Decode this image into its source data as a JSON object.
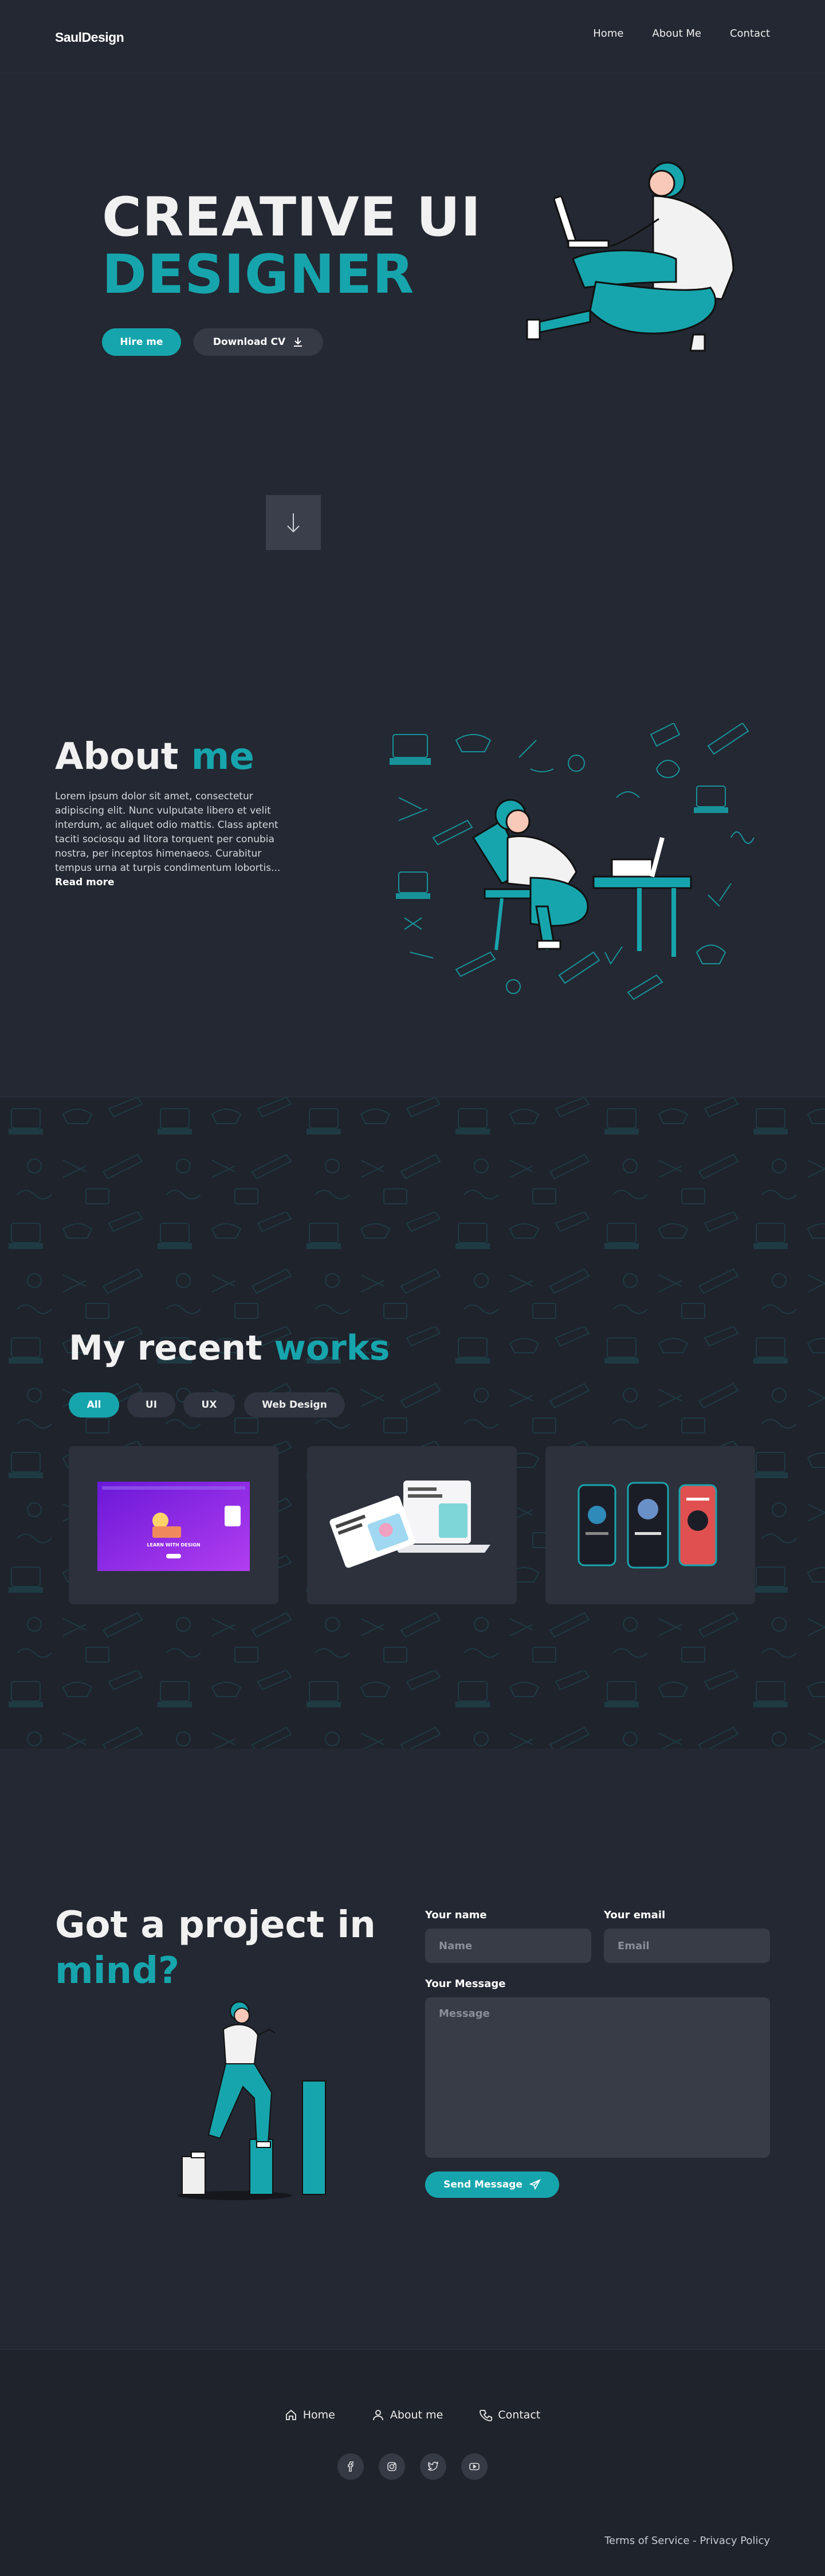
{
  "header": {
    "logo": "SaulDesign",
    "nav": [
      "Home",
      "About Me",
      "Contact"
    ]
  },
  "hero": {
    "title_line1": "CREATIVE UI",
    "title_line2": "DESIGNER",
    "hire_label": "Hire me",
    "download_label": "Download CV"
  },
  "about": {
    "title_white": "About",
    "title_accent": "me",
    "text": "Lorem ipsum dolor sit amet, consectetur adipiscing elit. Nunc vulputate libero et velit interdum, ac aliquet odio mattis. Class aptent taciti sociosqu ad litora torquent per conubia nostra, per inceptos himenaeos. Curabitur tempus urna at turpis condimentum lobortis...",
    "read_more": "Read more"
  },
  "works": {
    "title_white": "My recent",
    "title_accent": "works",
    "filters": [
      "All",
      "UI",
      "UX",
      "Web Design"
    ],
    "active_filter": "All",
    "card1_heading": "LEARN WITH DESIGN"
  },
  "contact": {
    "title_line1": "Got a project in",
    "title_line2": "mind?",
    "name_label": "Your name",
    "name_placeholder": "Name",
    "email_label": "Your email",
    "email_placeholder": "Email",
    "message_label": "Your Message",
    "message_placeholder": "Message",
    "send_label": "Send Message"
  },
  "footer": {
    "nav": [
      "Home",
      "About me",
      "Contact"
    ],
    "social_icons": [
      "facebook-icon",
      "instagram-icon",
      "twitter-icon",
      "youtube-icon"
    ],
    "legal": "Terms of Service - Privacy Policy"
  },
  "colors": {
    "accent": "#17a5ad",
    "background": "#232832",
    "surface": "#373c47"
  }
}
